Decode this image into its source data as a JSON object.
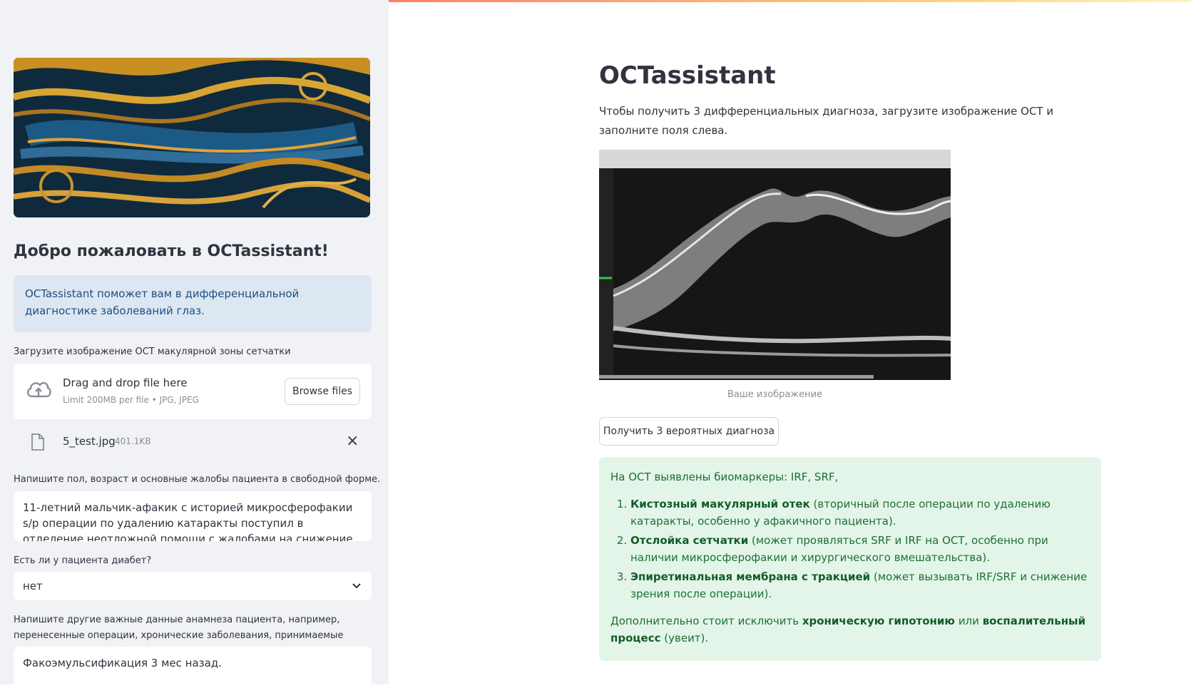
{
  "sidebar": {
    "title": "Добро пожаловать в OCTassistant!",
    "info": "OCTassistant поможет вам в дифференциальной диагностике заболеваний глаз.",
    "upload_label": "Загрузите изображение OCT макулярной зоны сетчатки",
    "uploader": {
      "drag_text": "Drag and drop file here",
      "limit_text": "Limit 200MB per file • JPG, JPEG",
      "browse_label": "Browse files"
    },
    "file": {
      "name": "5_test.jpg",
      "size": "401.1KB"
    },
    "complaints_label": "Напишите пол, возраст и основные жалобы пациента в свободной форме.",
    "complaints_value": "11-летний мальчик-афакик с историей микросферофакии s/p операции по удалению катаракты поступил в отделение неотложной помощи с жалобами на снижение зрения на левый",
    "diabetes_label": "Есть ли у пациента диабет?",
    "diabetes_value": "нет",
    "history_label": "Напишите другие важные данные анамнеза пациента, например, перенесенные операции, хронические заболевания, принимаемые препараты.",
    "history_value": "Факоэмульсификация 3 мес назад."
  },
  "main": {
    "title": "OCTassistant",
    "intro": "Чтобы получить 3 дифференциальных диагноза, загрузите изображение OCT и заполните поля слева.",
    "caption": "Ваше изображение",
    "diagnose_button": "Получить 3 вероятных диагноза",
    "result": {
      "biomarkers": "На OCT выявлены биомаркеры: IRF, SRF,",
      "items": [
        {
          "name": "Кистозный макулярный отек",
          "desc": "(вторичный после операции по удалению катаракты, особенно у афакичного пациента)."
        },
        {
          "name": "Отслойка сетчатки",
          "desc": "(может проявляться SRF и IRF на OCT, особенно при наличии микросферофакии и хирургического вмешательства)."
        },
        {
          "name": "Эпиретинальная мембрана с тракцией",
          "desc": "(может вызывать IRF/SRF и снижение зрения после операции)."
        }
      ],
      "extra_prefix": "Дополнительно стоит исключить",
      "extra_b1": "хроническую гипотонию",
      "extra_or": "или",
      "extra_b2": "воспалительный процесс",
      "extra_suffix": "(увеит)."
    }
  }
}
